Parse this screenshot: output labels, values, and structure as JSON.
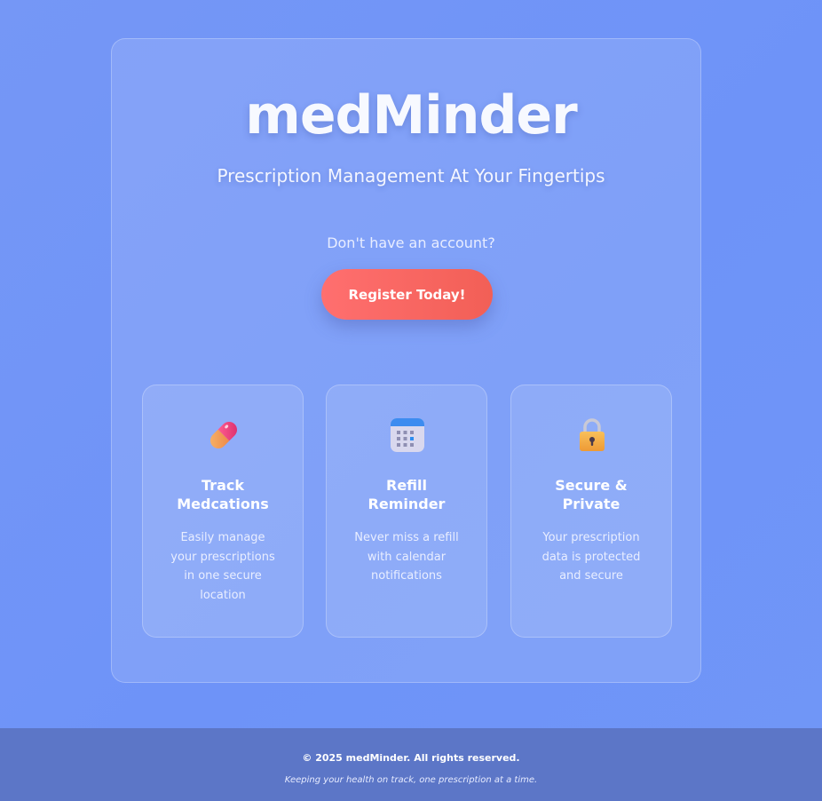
{
  "header": {
    "app_title": "medMinder",
    "tagline": "Prescription Management At Your Fingertips"
  },
  "signup": {
    "prompt": "Don't have an account?",
    "button_label": "Register Today!"
  },
  "features": [
    {
      "icon": "pill-icon",
      "title_lines": [
        "Track",
        "Medcations"
      ],
      "desc_lines": [
        "Easily manage",
        "your prescriptions",
        "in one secure",
        "location"
      ]
    },
    {
      "icon": "calendar-icon",
      "title_lines": [
        "Refill",
        "Reminder"
      ],
      "desc_lines": [
        "Never miss a refill",
        "with calendar",
        "notifications"
      ]
    },
    {
      "icon": "lock-icon",
      "title_lines": [
        "Secure &",
        "Private"
      ],
      "desc_lines": [
        "Your prescription",
        "data is protected",
        "and secure"
      ]
    }
  ],
  "footer": {
    "copyright": "© 2025 medMinder. All rights reserved.",
    "motto": "Keeping your health on track, one prescription at a time."
  },
  "colors": {
    "background": "#7396f7",
    "button": "#f76560",
    "footer": "#5c76c7"
  }
}
